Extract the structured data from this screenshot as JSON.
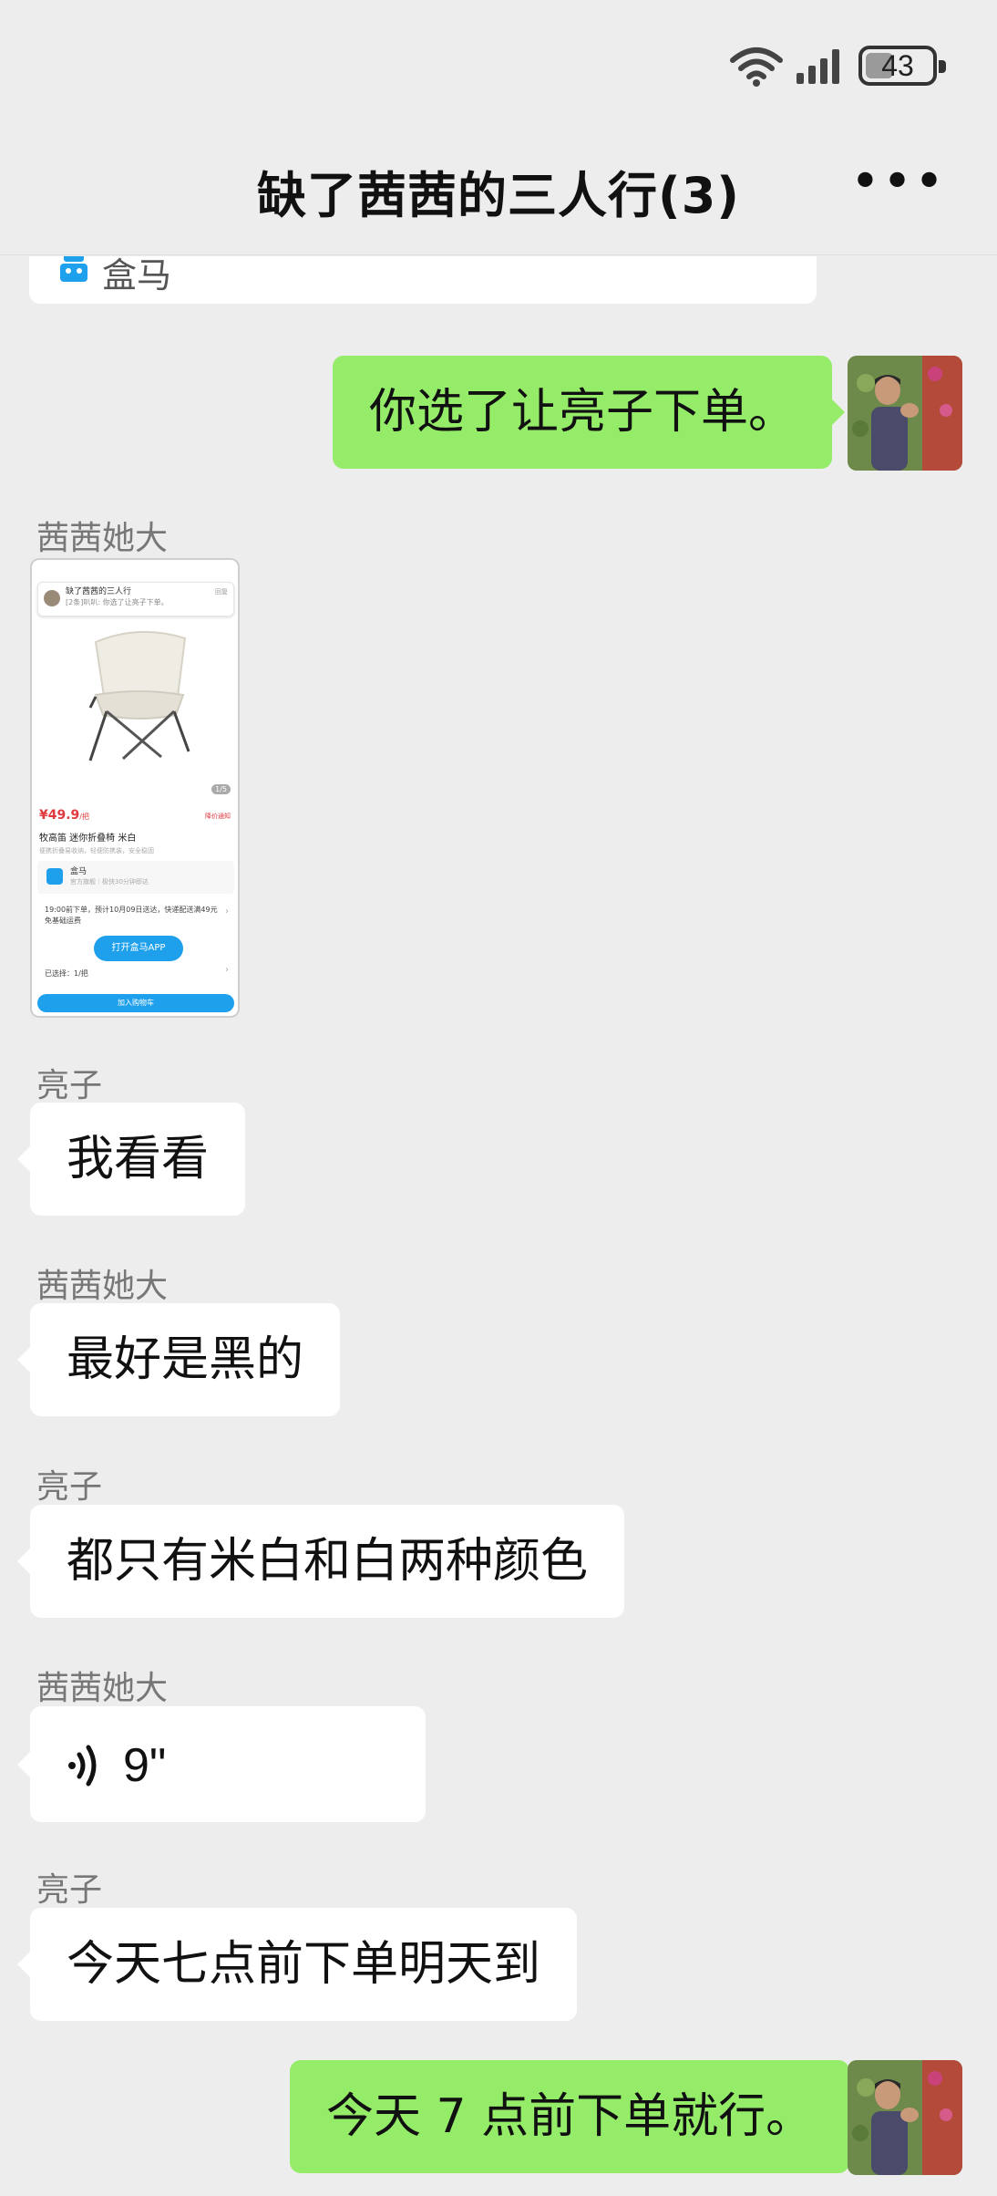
{
  "status_bar": {
    "battery": "43",
    "battery_level": 0.43,
    "icons": [
      "wifi-icon",
      "signal-icon",
      "battery-icon"
    ]
  },
  "header": {
    "title": "缺了茜茜的三人行(3)",
    "more_icon": "more-icon"
  },
  "colors": {
    "background": "#ededed",
    "bubble_self": "#95ec69",
    "bubble_other": "#ffffff",
    "accent_blue": "#1ea0ec"
  },
  "messages": {
    "card_tail": {
      "brand": "盒马",
      "icon": "hema-logo-icon"
    },
    "m1": {
      "side": "right",
      "text": "你选了让亮子下单。"
    },
    "m2": {
      "side": "left",
      "sender": "茜茜她大",
      "type": "image",
      "screenshot": {
        "notif_title": "缺了茜茜的三人行",
        "notif_sub": "[2条]叭叭: 你选了让亮子下单。",
        "notif_action": "回复",
        "page_indicator": "1/5",
        "price": "¥49.9",
        "price_unit": "/把",
        "tag": "降价通知",
        "product_name": "牧高笛 迷你折叠椅 米白",
        "product_desc": "便携折叠易收纳，轻便防携装，安全稳固",
        "store_name": "盒马",
        "store_desc": "官方旗舰｜极快30分钟即达",
        "delivery": "19:00前下单，预计10月09日送达，快递配送满49元免基础运费",
        "open_app": "打开盒马APP",
        "selected": "已选择：1/把",
        "add_cart": "加入购物车"
      }
    },
    "m3": {
      "side": "left",
      "sender": "亮子",
      "text": "我看看"
    },
    "m4": {
      "side": "left",
      "sender": "茜茜她大",
      "text": "最好是黑的"
    },
    "m5": {
      "side": "left",
      "sender": "亮子",
      "text": "都只有米白和白两种颜色"
    },
    "m6": {
      "side": "left",
      "sender": "茜茜她大",
      "type": "voice",
      "duration": "9\"",
      "icon": "voice-icon"
    },
    "m7": {
      "side": "left",
      "sender": "亮子",
      "text": "今天七点前下单明天到"
    },
    "m8": {
      "side": "right",
      "text": "今天 7 点前下单就行。"
    }
  }
}
